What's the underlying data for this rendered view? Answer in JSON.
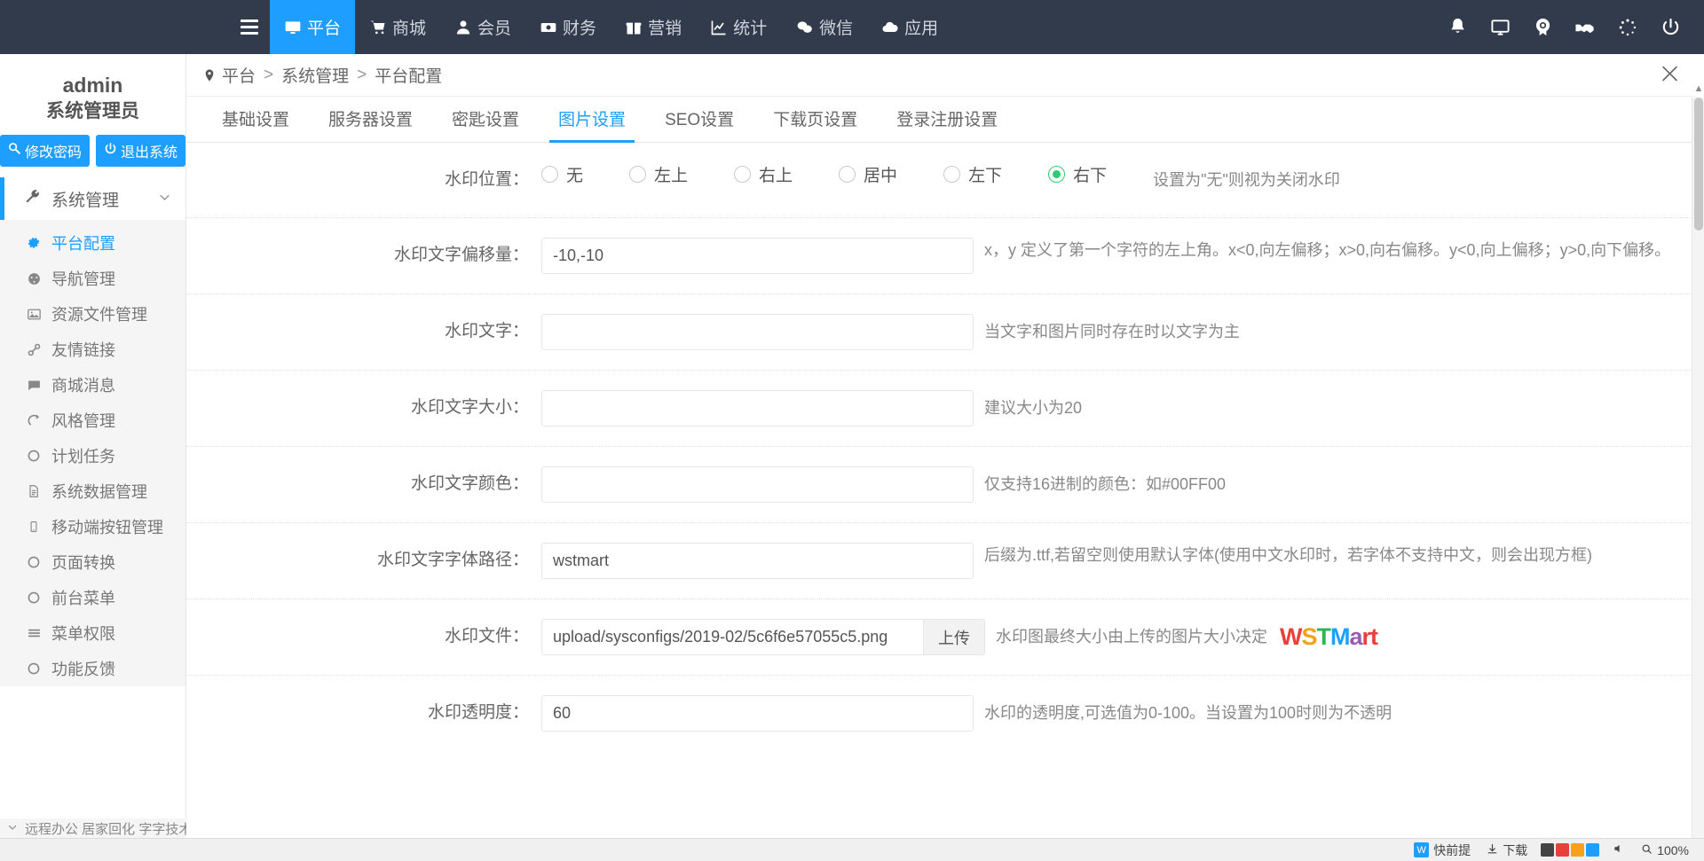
{
  "topnav": {
    "menu_icon": "hamburger-icon",
    "items": [
      {
        "label": "平台",
        "icon": "monitor-icon",
        "active": true
      },
      {
        "label": "商城",
        "icon": "cart-icon",
        "active": false
      },
      {
        "label": "会员",
        "icon": "user-icon",
        "active": false
      },
      {
        "label": "财务",
        "icon": "money-icon",
        "active": false
      },
      {
        "label": "营销",
        "icon": "gift-icon",
        "active": false
      },
      {
        "label": "统计",
        "icon": "chart-icon",
        "active": false
      },
      {
        "label": "微信",
        "icon": "wechat-icon",
        "active": false
      },
      {
        "label": "应用",
        "icon": "cloud-icon",
        "active": false
      }
    ],
    "right_icons": [
      "bell-icon",
      "screen-icon",
      "broadcast-icon",
      "handshake-icon",
      "loading-spinner-icon",
      "power-icon"
    ],
    "active_color": "#1e9fff",
    "background": "#323b4c"
  },
  "sidebar": {
    "user_name": "admin",
    "user_role": "系统管理员",
    "change_password_label": "修改密码",
    "logout_label": "退出系统",
    "group": {
      "label": "系统管理",
      "icon": "wrench-icon",
      "chevron": "chevron-down-icon"
    },
    "items": [
      {
        "label": "平台配置",
        "icon": "gear-icon",
        "active": true
      },
      {
        "label": "导航管理",
        "icon": "dashboard-icon",
        "active": false
      },
      {
        "label": "资源文件管理",
        "icon": "image-icon",
        "active": false
      },
      {
        "label": "友情链接",
        "icon": "link-icon",
        "active": false
      },
      {
        "label": "商城消息",
        "icon": "comment-icon",
        "active": false
      },
      {
        "label": "风格管理",
        "icon": "style-icon",
        "active": false
      },
      {
        "label": "计划任务",
        "icon": "circle-icon",
        "active": false
      },
      {
        "label": "系统数据管理",
        "icon": "file-icon",
        "active": false
      },
      {
        "label": "移动端按钮管理",
        "icon": "mobile-icon",
        "active": false
      },
      {
        "label": "页面转换",
        "icon": "circle-icon",
        "active": false
      },
      {
        "label": "前台菜单",
        "icon": "circle-icon",
        "active": false
      },
      {
        "label": "菜单权限",
        "icon": "list-icon",
        "active": false
      },
      {
        "label": "功能反馈",
        "icon": "circle-icon",
        "active": false
      }
    ],
    "bottom_strip": "远程办公 居家回化 字字技术指南"
  },
  "breadcrumb": {
    "pin_icon": "location-pin-icon",
    "parts": [
      "平台",
      "系统管理",
      "平台配置"
    ],
    "separator": ">",
    "fullscreen_icon": "fullscreen-exit-icon"
  },
  "tabs": [
    {
      "label": "基础设置",
      "active": false
    },
    {
      "label": "服务器设置",
      "active": false
    },
    {
      "label": "密匙设置",
      "active": false
    },
    {
      "label": "图片设置",
      "active": true
    },
    {
      "label": "SEO设置",
      "active": false
    },
    {
      "label": "下载页设置",
      "active": false
    },
    {
      "label": "登录注册设置",
      "active": false
    }
  ],
  "form": {
    "watermark_position": {
      "label": "水印位置：",
      "options": [
        {
          "label": "无",
          "checked": false
        },
        {
          "label": "左上",
          "checked": false
        },
        {
          "label": "右上",
          "checked": false
        },
        {
          "label": "居中",
          "checked": false
        },
        {
          "label": "左下",
          "checked": false
        },
        {
          "label": "右下",
          "checked": true
        }
      ],
      "hint": "设置为\"无\"则视为关闭水印",
      "checked_color": "#2ecc71"
    },
    "text_offset": {
      "label": "水印文字偏移量：",
      "value": "-10,-10",
      "placeholder": "",
      "hint": "x，y 定义了第一个字符的左上角。x<0,向左偏移；x>0,向右偏移。y<0,向上偏移；y>0,向下偏移。"
    },
    "watermark_text": {
      "label": "水印文字：",
      "value": "",
      "placeholder": "",
      "hint": "当文字和图片同时存在时以文字为主"
    },
    "text_size": {
      "label": "水印文字大小：",
      "value": "",
      "placeholder": "",
      "hint": "建议大小为20"
    },
    "text_color": {
      "label": "水印文字颜色：",
      "value": "",
      "placeholder": "",
      "hint": "仅支持16进制的颜色：如#00FF00"
    },
    "font_path": {
      "label": "水印文字字体路径：",
      "value": "wstmart",
      "placeholder": "",
      "hint": "后缀为.ttf,若留空则使用默认字体(使用中文水印时，若字体不支持中文，则会出现方框)"
    },
    "watermark_file": {
      "label": "水印文件：",
      "value": "upload/sysconfigs/2019-02/5c6f6e57055c5.png",
      "placeholder": "",
      "upload_label": "上传",
      "hint": "水印图最终大小由上传的图片大小决定",
      "logo_text": "WSTMart"
    },
    "opacity": {
      "label": "水印透明度：",
      "value": "60",
      "placeholder": "",
      "hint": "水印的透明度,可选值为0-100。当设置为100时则为不透明"
    }
  },
  "taskbar": {
    "items": [
      {
        "label": "快前提",
        "icon": "blue-square-icon"
      },
      {
        "label": "下载",
        "icon": "download-icon"
      }
    ],
    "zoom_label": "100%",
    "search_icon": "search-icon",
    "speaker_icon": "speaker-icon"
  }
}
